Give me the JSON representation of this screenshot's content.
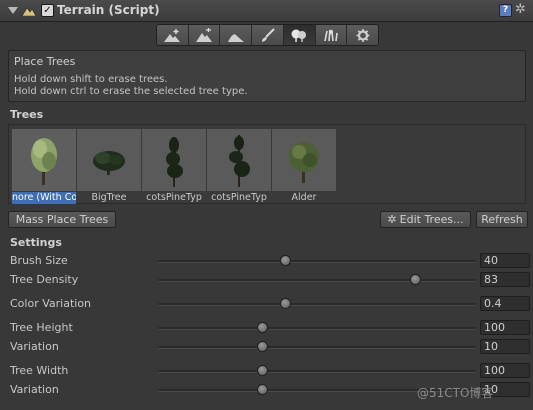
{
  "component": {
    "title": "Terrain (Script)",
    "enabled_mark": "✓",
    "help_mark": "?",
    "gear_glyph": "✲",
    "fold_icon": "fold-triangle-icon",
    "component_icon": "terrain-icon"
  },
  "toolbar": {
    "tools": [
      {
        "name": "raise-lower-terrain-icon"
      },
      {
        "name": "paint-height-icon"
      },
      {
        "name": "smooth-height-icon"
      },
      {
        "name": "paint-texture-icon"
      },
      {
        "name": "place-trees-icon",
        "active": true
      },
      {
        "name": "paint-details-icon"
      },
      {
        "name": "terrain-settings-icon"
      }
    ]
  },
  "info": {
    "title": "Place Trees",
    "line1": "Hold down shift to erase trees.",
    "line2": "Hold down ctrl to erase the selected tree type."
  },
  "trees_section": {
    "title": "Trees",
    "items": [
      {
        "label": "nore (With Co",
        "selected": true
      },
      {
        "label": "BigTree"
      },
      {
        "label": "cotsPineTyp"
      },
      {
        "label": "cotsPineTyp"
      },
      {
        "label": "Alder"
      }
    ]
  },
  "buttons": {
    "mass_place": "Mass Place Trees",
    "edit_trees": "Edit Trees...",
    "edit_trees_icon": "gear-icon",
    "refresh": "Refresh"
  },
  "settings": {
    "title": "Settings",
    "params": [
      {
        "label": "Brush Size",
        "value": "40",
        "level": 0.4
      },
      {
        "label": "Tree Density",
        "value": "83",
        "level": 0.81
      },
      {
        "label": "Color Variation",
        "value": "0.4",
        "level": 0.4
      },
      {
        "label": "Tree Height",
        "value": "100",
        "level": 0.33
      },
      {
        "label": "Variation",
        "value": "10",
        "level": 0.33
      },
      {
        "label": "Tree Width",
        "value": "100",
        "level": 0.33
      },
      {
        "label": "Variation",
        "value": "10",
        "level": 0.33
      }
    ]
  },
  "watermark": "@51CTO博客"
}
